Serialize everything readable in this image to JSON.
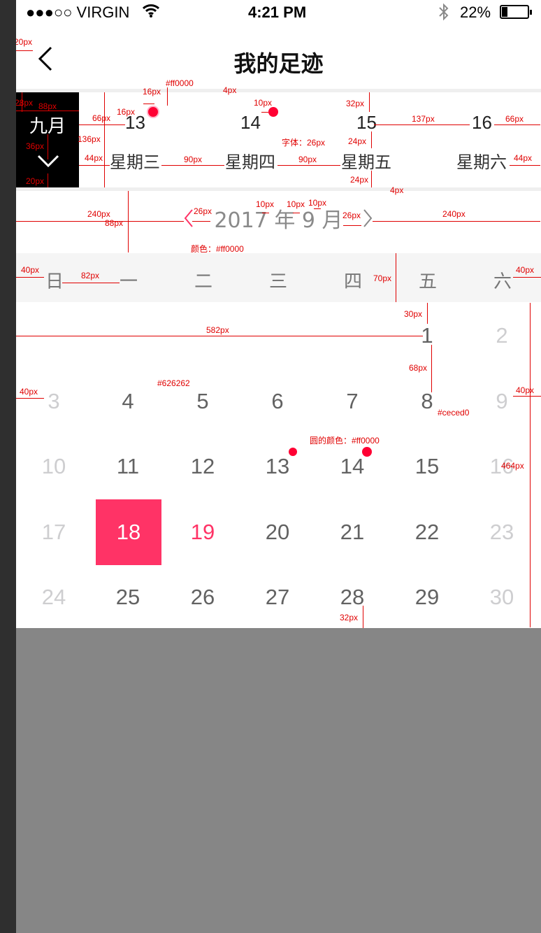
{
  "status_bar": {
    "carrier": "●●●○○ VIRGIN",
    "time": "4:21 PM",
    "battery": "22%"
  },
  "nav": {
    "title": "我的足迹"
  },
  "week_strip": {
    "month_label": "九月",
    "days": [
      {
        "num": "13",
        "name": "星期三"
      },
      {
        "num": "14",
        "name": "星期四"
      },
      {
        "num": "15",
        "name": "星期五"
      },
      {
        "num": "16",
        "name": "星期六"
      }
    ]
  },
  "month_nav": {
    "label": "2017 年 9 月"
  },
  "weekdays": [
    "日",
    "一",
    "二",
    "三",
    "四",
    "五",
    "六"
  ],
  "calendar_rows": [
    [
      {
        "d": ""
      },
      {
        "d": ""
      },
      {
        "d": ""
      },
      {
        "d": ""
      },
      {
        "d": ""
      },
      {
        "d": "1"
      },
      {
        "d": "2"
      }
    ],
    [
      {
        "d": "3"
      },
      {
        "d": "4"
      },
      {
        "d": "5"
      },
      {
        "d": "6"
      },
      {
        "d": "7"
      },
      {
        "d": "8"
      },
      {
        "d": "9"
      }
    ],
    [
      {
        "d": "10"
      },
      {
        "d": "11"
      },
      {
        "d": "12"
      },
      {
        "d": "13"
      },
      {
        "d": "14"
      },
      {
        "d": "15"
      },
      {
        "d": "16"
      }
    ],
    [
      {
        "d": "17"
      },
      {
        "d": "18"
      },
      {
        "d": "19"
      },
      {
        "d": "20"
      },
      {
        "d": "21"
      },
      {
        "d": "22"
      },
      {
        "d": "23"
      }
    ],
    [
      {
        "d": "24"
      },
      {
        "d": "25"
      },
      {
        "d": "26"
      },
      {
        "d": "27"
      },
      {
        "d": "28"
      },
      {
        "d": "29"
      },
      {
        "d": "30"
      }
    ]
  ],
  "colors": {
    "accent": "#ff0000",
    "selected": "#ff3366",
    "text": "#626262",
    "muted": "#ceced0"
  },
  "annotations": {
    "a_20": "20px",
    "a_28": "28px",
    "a_88": "88px",
    "a_66": "66px",
    "a_136": "136px",
    "a_36": "36px",
    "a_20b": "20px",
    "a_16a": "16px",
    "a_16b": "16px",
    "a_ff0000": "#ff0000",
    "a_4a": "4px",
    "a_10": "10px",
    "a_32": "32px",
    "a_font": "字体：26px",
    "a_44a": "44px",
    "a_90a": "90px",
    "a_90b": "90px",
    "a_24a": "24px",
    "a_24b": "24px",
    "a_137": "137px",
    "a_66b": "66px",
    "a_44b": "44px",
    "a_4b": "4px",
    "a_240a": "240px",
    "a_88b": "88px",
    "a_26a": "26px",
    "a_10a": "10px",
    "a_10b": "10px",
    "a_10c": "10px",
    "a_26b": "26px",
    "a_240b": "240px",
    "a_color": "颜色：#ff0000",
    "a_40a": "40px",
    "a_82": "82px",
    "a_70": "70px",
    "a_40b": "40px",
    "a_30": "30px",
    "a_582": "582px",
    "a_68": "68px",
    "a_626262": "#626262",
    "a_40c": "40px",
    "a_40d": "40px",
    "a_ceced0": "#ceced0",
    "a_circle": "圆的颜色：#ff0000",
    "a_464": "464px",
    "a_32b": "32px"
  }
}
